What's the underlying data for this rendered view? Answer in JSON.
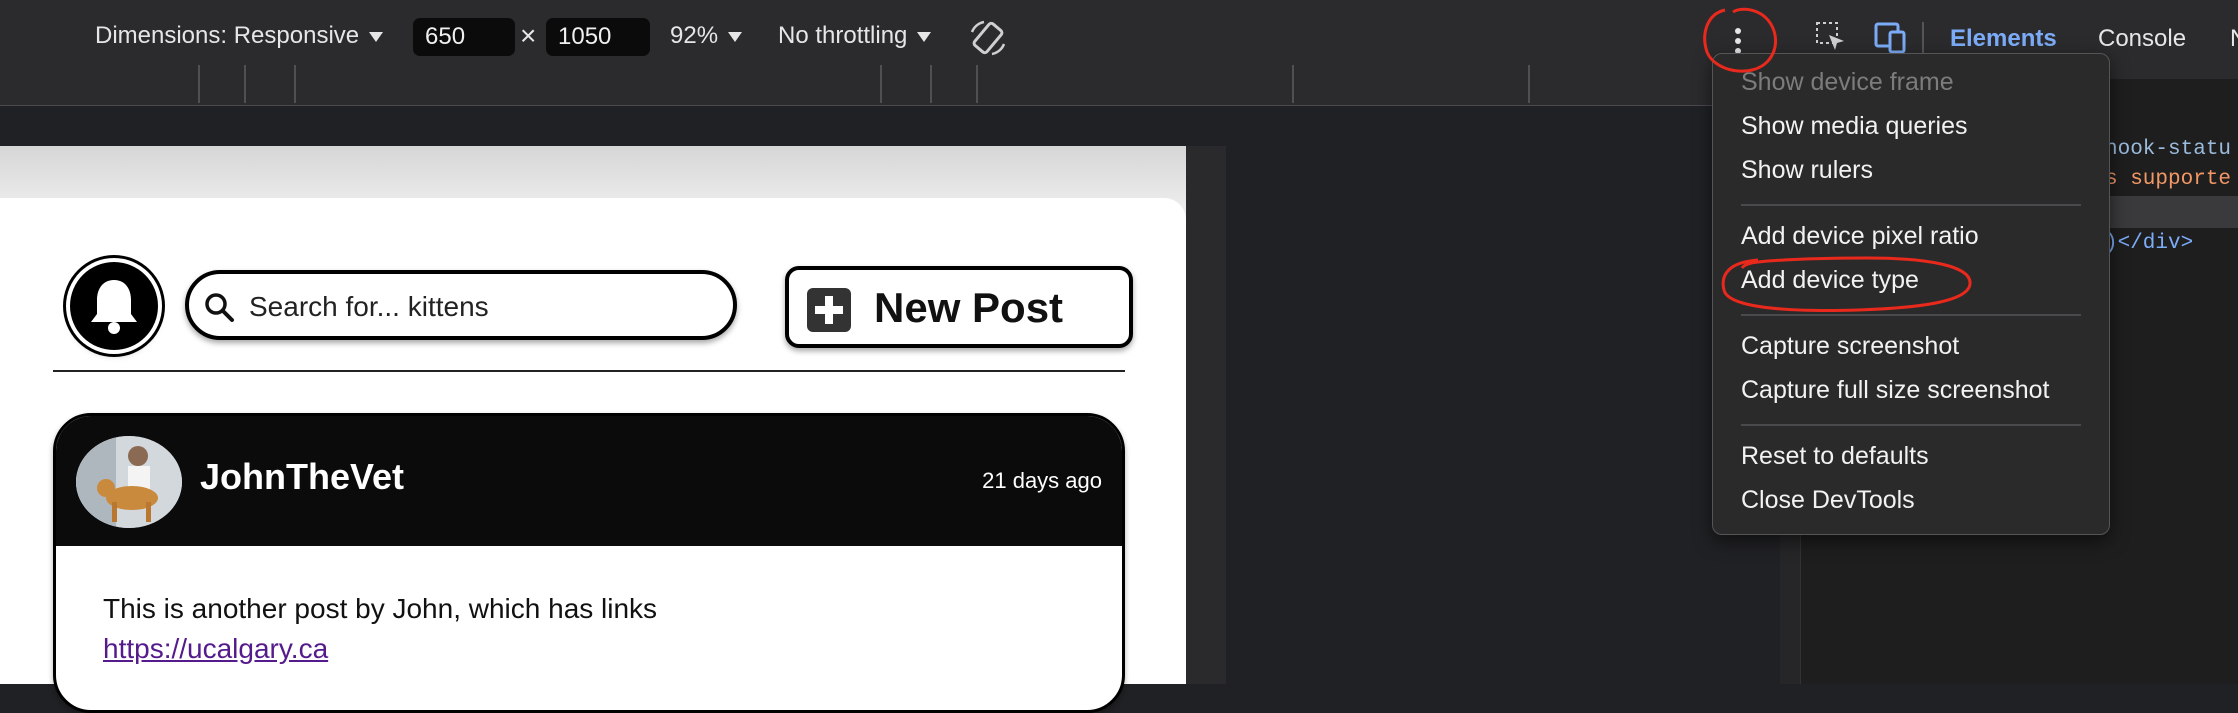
{
  "devtools_toolbar": {
    "dimensions_label": "Dimensions: Responsive",
    "width_value": "650",
    "times": "×",
    "height_value": "1050",
    "zoom": "92%",
    "throttling": "No throttling"
  },
  "devtools_tabs": {
    "elements": "Elements",
    "console": "Console",
    "more": "N"
  },
  "code_snippets": {
    "line1": "hook-statu",
    "line2": "s supporte",
    "line3": ")</div>"
  },
  "menu": {
    "items": [
      {
        "label": "Show device frame",
        "disabled": true
      },
      {
        "label": "Show media queries"
      },
      {
        "label": "Show rulers"
      },
      {
        "label": "Add device pixel ratio"
      },
      {
        "label": "Add device type"
      },
      {
        "label": "Capture screenshot"
      },
      {
        "label": "Capture full size screenshot"
      },
      {
        "label": "Reset to defaults"
      },
      {
        "label": "Close DevTools"
      }
    ]
  },
  "app": {
    "search_placeholder": "Search for... kittens",
    "new_post_label": "New Post",
    "post": {
      "username": "JohnTheVet",
      "time": "21 days ago",
      "body": "This is another post by John, which has links",
      "link": "https://ucalgary.ca"
    }
  },
  "colors": {
    "annotation": "#e8291c",
    "devtools_bg": "#2b2b2d",
    "accent_blue": "#7cacf8"
  },
  "icons": [
    "rotate-icon",
    "more-vert-icon",
    "inspect-icon",
    "device-toggle-icon",
    "bell-icon",
    "search-icon",
    "plus-icon",
    "caret-down-icon"
  ]
}
